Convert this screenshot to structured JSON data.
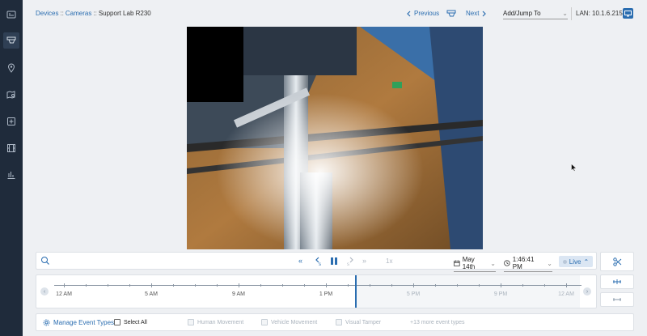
{
  "sidebar": {
    "items": [
      {
        "name": "dashboard",
        "icon": "dashboard-icon"
      },
      {
        "name": "cameras",
        "icon": "camera-icon",
        "active": true
      },
      {
        "name": "locations",
        "icon": "map-pin-icon"
      },
      {
        "name": "maps",
        "icon": "map-search-icon"
      },
      {
        "name": "add",
        "icon": "plus-box-icon"
      },
      {
        "name": "video",
        "icon": "film-icon"
      },
      {
        "name": "reports",
        "icon": "bar-chart-icon"
      }
    ]
  },
  "breadcrumb": {
    "devices": "Devices",
    "cameras": "Cameras",
    "current": "Support Lab R230",
    "separator": "::"
  },
  "nav": {
    "previous": "Previous",
    "next": "Next",
    "jump_label": "Add/Jump To",
    "lan": "LAN: 10.1.6.215"
  },
  "controls": {
    "speed": "1x",
    "date": "May 14th",
    "time": "1:46:41 PM",
    "live": "Live"
  },
  "timeline": {
    "labels": [
      "12 AM",
      "5 AM",
      "9 AM",
      "1 PM",
      "5 PM",
      "9 PM",
      "12 AM"
    ]
  },
  "events": {
    "manage": "Manage Event Types",
    "select_all": "Select All",
    "types": [
      "Human Movement",
      "Vehicle Movement",
      "Visual Tamper"
    ],
    "more": "+13 more event types"
  },
  "colors": {
    "accent": "#2a6db0",
    "sidebar": "#1f2b3b",
    "background": "#eef0f3"
  }
}
